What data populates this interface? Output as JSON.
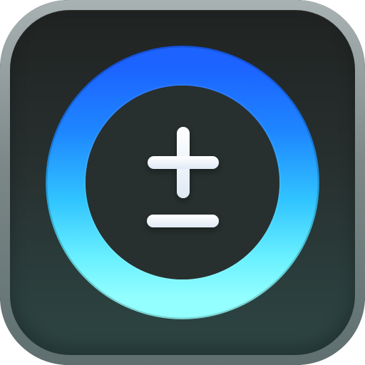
{
  "app": {
    "icon_name": "plus-minus-icon",
    "accent_color": "#27a7ff",
    "ring_color_top": "#1b6cff",
    "ring_color_bottom": "#74f3ff",
    "symbol_color": "#f3f8ff",
    "background_color": "#23302f"
  }
}
